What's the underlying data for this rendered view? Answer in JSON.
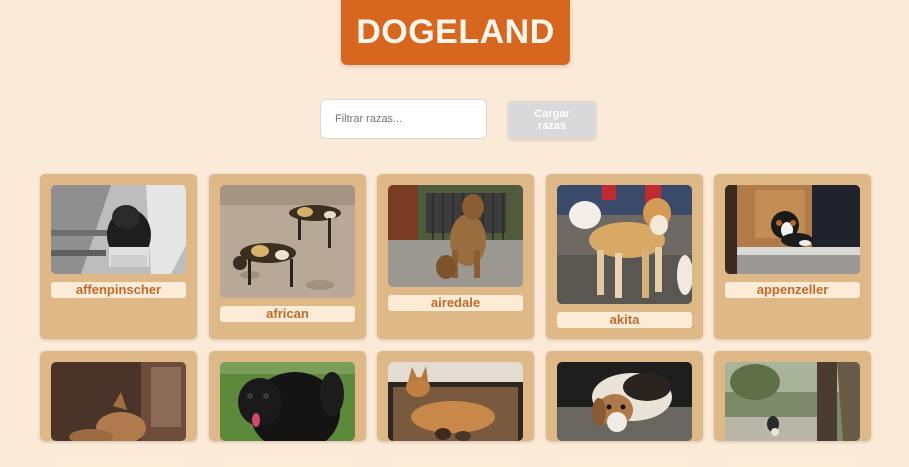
{
  "header": {
    "title": "DOGELAND"
  },
  "filter": {
    "placeholder": "Filtrar razas..."
  },
  "load_button": {
    "label": "Cargar razas"
  },
  "breeds": [
    {
      "name": "affenpinscher"
    },
    {
      "name": "african"
    },
    {
      "name": "airedale"
    },
    {
      "name": "akita"
    },
    {
      "name": "appenzeller"
    },
    {
      "name": ""
    },
    {
      "name": ""
    },
    {
      "name": ""
    },
    {
      "name": ""
    },
    {
      "name": ""
    }
  ],
  "colors": {
    "background": "#fbead7",
    "title_bg": "#d7661f",
    "card_bg": "#dfb888",
    "label_bg": "#fcebd6",
    "label_text": "#c16a2b"
  }
}
